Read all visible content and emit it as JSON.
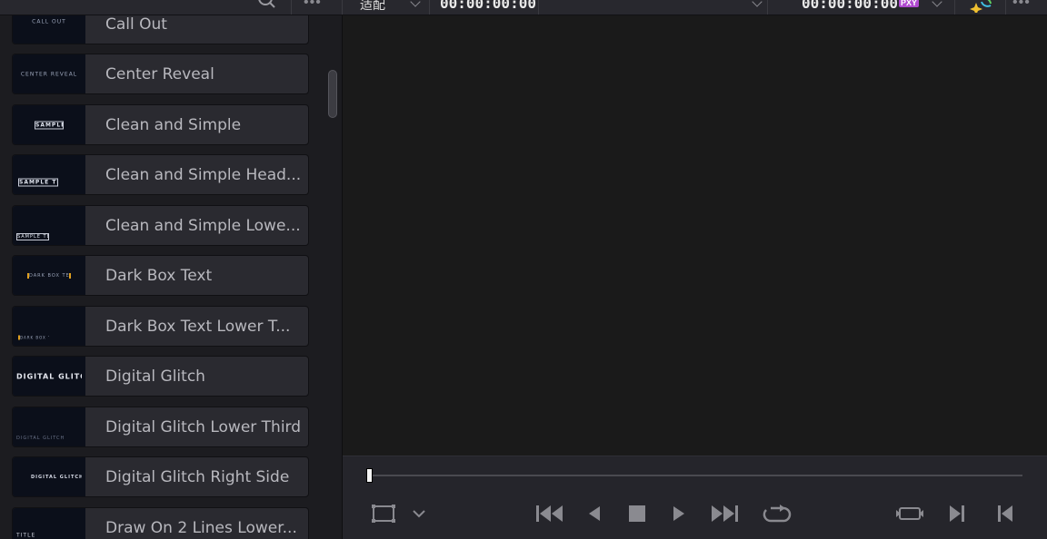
{
  "topbar": {
    "fit_label": "适配",
    "timecode_left": "00:00:00:00",
    "timecode_right": "00:00:00:00",
    "proxy_badge": "PXY"
  },
  "effects_list": [
    {
      "label": "Call Out",
      "thumb_text": "CALL OUT"
    },
    {
      "label": "Center Reveal",
      "thumb_text": "CENTER REVEAL"
    },
    {
      "label": "Clean and Simple",
      "thumb_text": "SAMPLE TEXT"
    },
    {
      "label": "Clean and Simple Head...",
      "thumb_text": "SAMPLE TEXT"
    },
    {
      "label": "Clean and Simple Lowe...",
      "thumb_text": "SAMPLE TEXT"
    },
    {
      "label": "Dark Box Text",
      "thumb_text": "DARK BOX TEXT"
    },
    {
      "label": "Dark Box Text Lower T...",
      "thumb_text": "DARK BOX TEXT"
    },
    {
      "label": "Digital Glitch",
      "thumb_text": "DIGITAL GLITCH"
    },
    {
      "label": "Digital Glitch Lower Third",
      "thumb_text": "DIGITAL GLITCH"
    },
    {
      "label": "Digital Glitch Right Side",
      "thumb_text": "DIGITAL GLITCH"
    },
    {
      "label": "Draw On 2 Lines Lower...",
      "thumb_text": "TITLE"
    }
  ],
  "transport": {
    "playhead_position": 0,
    "icons": [
      "transform-icon",
      "chevron-down-icon",
      "jump-to-start-icon",
      "play-reverse-icon",
      "stop-icon",
      "play-icon",
      "jump-to-end-icon",
      "loop-icon",
      "match-frame-icon",
      "next-edit-icon",
      "previous-edit-icon"
    ]
  }
}
